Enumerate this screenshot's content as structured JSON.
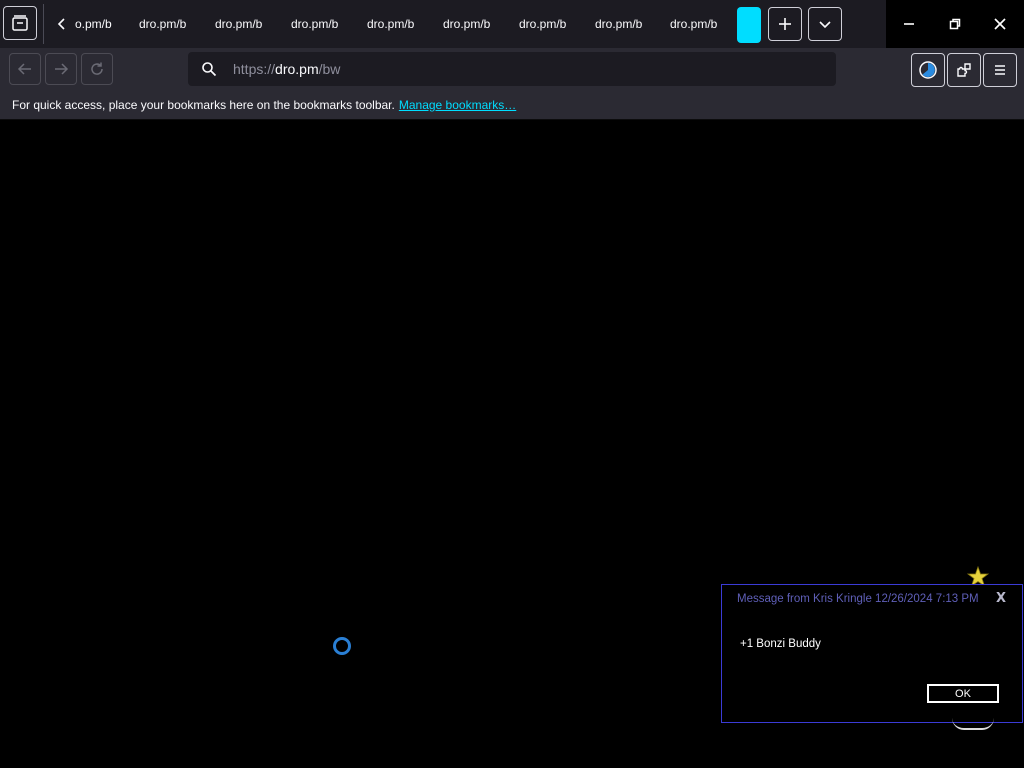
{
  "tabs": [
    {
      "label": "o.pm/b"
    },
    {
      "label": "dro.pm/b"
    },
    {
      "label": "dro.pm/b"
    },
    {
      "label": "dro.pm/b"
    },
    {
      "label": "dro.pm/b"
    },
    {
      "label": "dro.pm/b"
    },
    {
      "label": "dro.pm/b"
    },
    {
      "label": "dro.pm/b"
    },
    {
      "label": "dro.pm/b"
    }
  ],
  "urlbar": {
    "scheme": "https://",
    "host": "dro.pm",
    "path": "/bw"
  },
  "bookmarks": {
    "message": "For quick access, place your bookmarks here on the bookmarks toolbar.",
    "link": "Manage bookmarks…"
  },
  "message_box": {
    "title": "Message from Kris Kringle 12/26/2024 7:13 PM",
    "body": "+1 Bonzi Buddy",
    "ok_label": "OK",
    "close_glyph": "X"
  },
  "colors": {
    "accent": "#00ddff",
    "toolbar": "#2b2a33",
    "tabbar": "#1c1b22"
  },
  "icons": [
    "tab-tray-icon",
    "chevron-left-icon",
    "plus-icon",
    "chevron-down-icon",
    "minimize-icon",
    "restore-icon",
    "close-icon",
    "back-arrow-icon",
    "forward-arrow-icon",
    "reload-icon",
    "search-icon",
    "account-icon",
    "extensions-icon",
    "menu-icon",
    "star-icon",
    "loading-spinner-icon"
  ]
}
